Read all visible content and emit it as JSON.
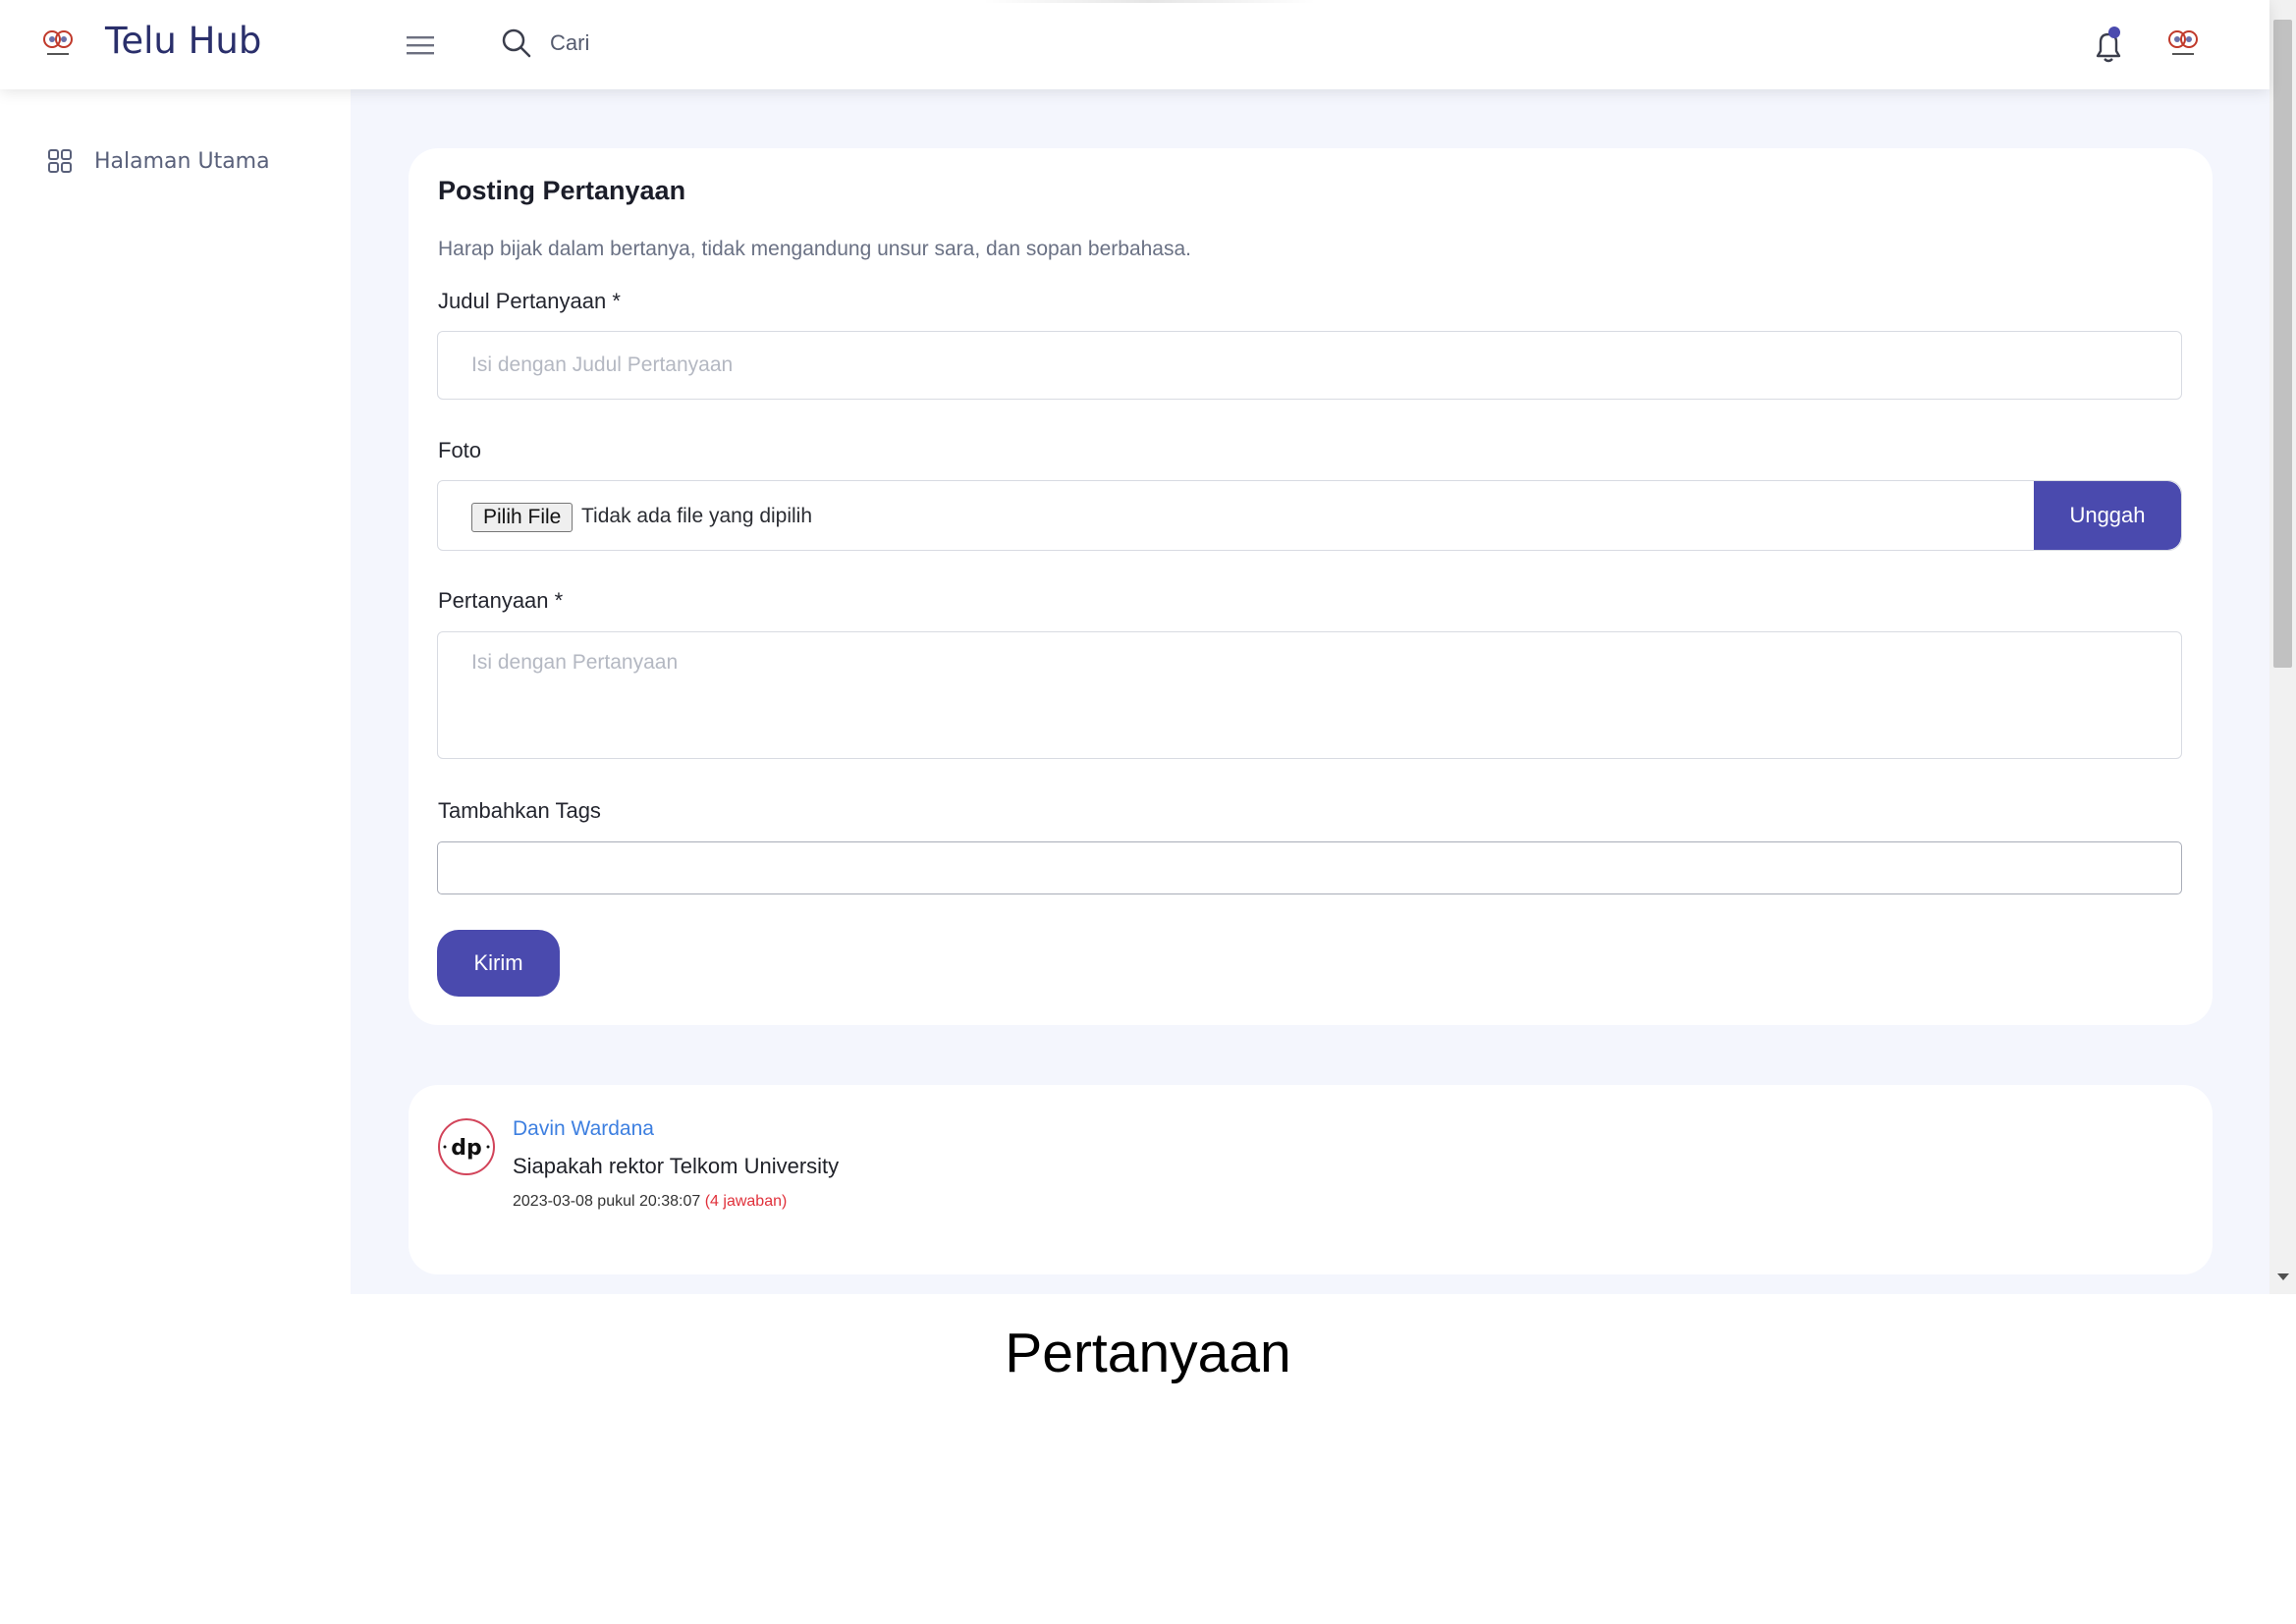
{
  "topbar": {
    "brand": "Telu Hub",
    "logo_icon": "telu-hub-logo-icon",
    "search_placeholder": "Cari",
    "menu_icon": "hamburger-menu-icon",
    "notification_icon": "bell-icon",
    "accent": "#4a4aae"
  },
  "sidebar": {
    "items": [
      {
        "label": "Halaman Utama",
        "icon": "grid-icon"
      }
    ]
  },
  "form": {
    "title": "Posting Pertanyaan",
    "hint": "Harap bijak dalam bertanya, tidak mengandung unsur sara, dan sopan berbahasa.",
    "title_label": "Judul Pertanyaan *",
    "title_placeholder": "Isi dengan Judul Pertanyaan",
    "photo_label": "Foto",
    "file_button": "Pilih File",
    "file_status": "Tidak ada file yang dipilih",
    "upload_button": "Unggah",
    "question_label": "Pertanyaan *",
    "question_placeholder": "Isi dengan Pertanyaan",
    "tags_label": "Tambahkan Tags",
    "tags_value": "",
    "submit_button": "Kirim"
  },
  "posts": [
    {
      "author": "Davin Wardana",
      "avatar_text": "dp",
      "title": "Siapakah rektor Telkom University",
      "date": "2023-03-08 pukul 20:38:07",
      "answers": "(4 jawaban)"
    }
  ],
  "caption": "Pertanyaan"
}
